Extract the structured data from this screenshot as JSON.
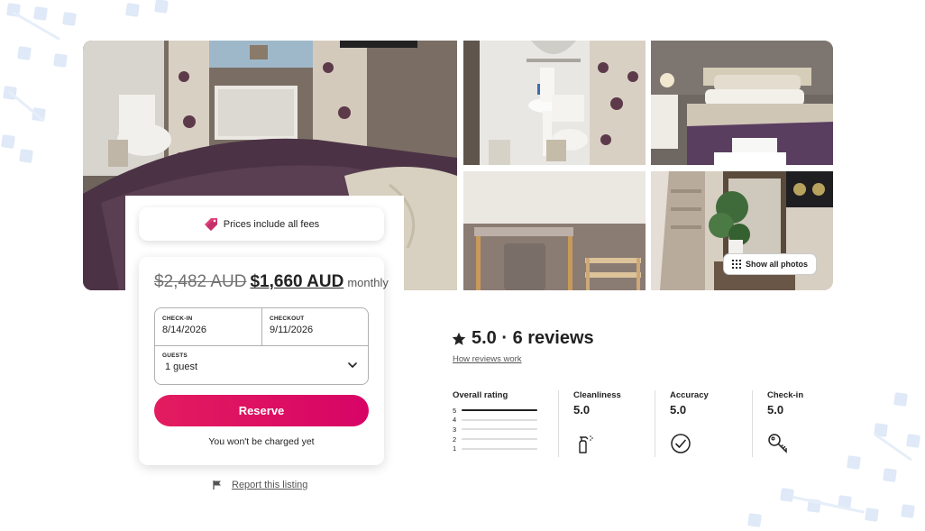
{
  "gallery": {
    "show_all_label": "Show all photos"
  },
  "booking": {
    "fees_note": "Prices include all fees",
    "original_price": "$2,482 AUD",
    "price": "$1,660 AUD",
    "period": "monthly",
    "checkin_label": "CHECK-IN",
    "checkin_value": "8/14/2026",
    "checkout_label": "CHECKOUT",
    "checkout_value": "9/11/2026",
    "guests_label": "GUESTS",
    "guests_value": "1 guest",
    "reserve_label": "Reserve",
    "no_charge_note": "You won't be charged yet",
    "report_label": "Report this listing",
    "accent_color": "#e31c5f"
  },
  "reviews": {
    "heading": "5.0 · 6 reviews",
    "how_reviews_work": "How reviews work",
    "overall_title": "Overall rating",
    "distribution": [
      {
        "stars": "5",
        "fraction": 1.0
      },
      {
        "stars": "4",
        "fraction": 0.0
      },
      {
        "stars": "3",
        "fraction": 0.0
      },
      {
        "stars": "2",
        "fraction": 0.0
      },
      {
        "stars": "1",
        "fraction": 0.0
      }
    ],
    "categories": [
      {
        "title": "Cleanliness",
        "value": "5.0",
        "icon": "spray-bottle-icon"
      },
      {
        "title": "Accuracy",
        "value": "5.0",
        "icon": "check-circle-icon"
      },
      {
        "title": "Check-in",
        "value": "5.0",
        "icon": "key-icon"
      }
    ]
  }
}
